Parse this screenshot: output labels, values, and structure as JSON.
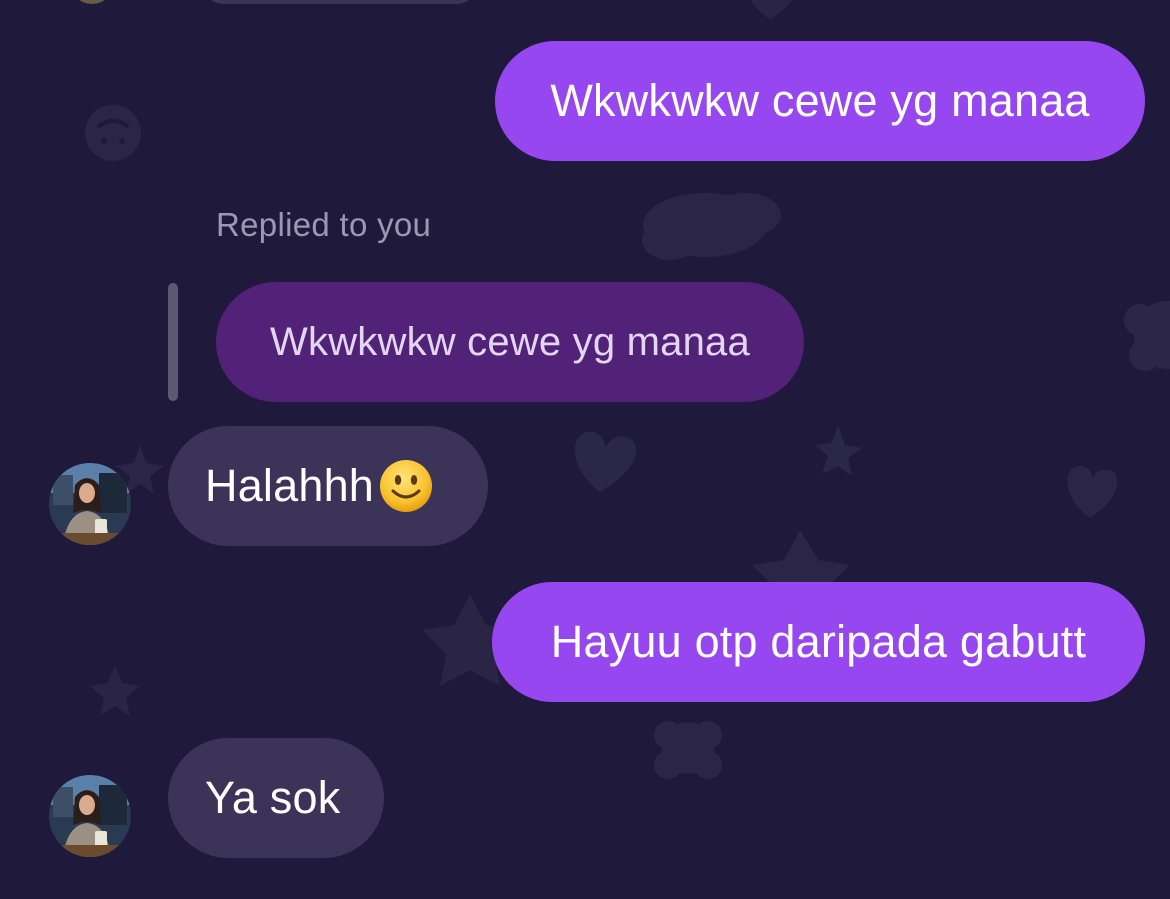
{
  "theme": {
    "background": "#1f1a3b",
    "outgoing_bubble": "#9747ef",
    "incoming_bubble": "#3c3458",
    "quoted_bubble": "#522279",
    "secondary_text": "#9d98b0"
  },
  "messages": [
    {
      "direction": "outgoing",
      "text": "Wkwkwkw cewe yg manaa"
    },
    {
      "direction": "incoming",
      "reply_label": "Replied to you",
      "quoted_text": "Wkwkwkw cewe yg manaa",
      "text": "Halahhh",
      "emoji": "slightly-smiling-face"
    },
    {
      "direction": "outgoing",
      "text": "Hayuu otp daripada gabutt"
    },
    {
      "direction": "incoming",
      "text": "Ya sok"
    }
  ]
}
